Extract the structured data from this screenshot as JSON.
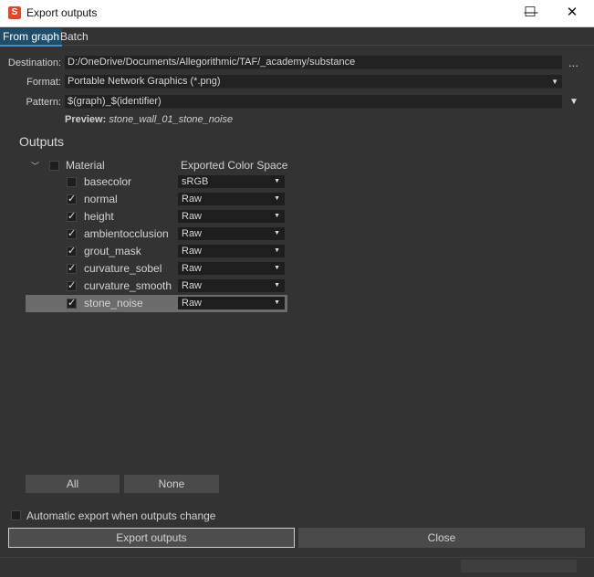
{
  "window": {
    "title": "Export outputs",
    "app_icon": "S",
    "controls": {
      "minimize": "—",
      "maximize": "☐",
      "close": "✕"
    }
  },
  "tabs": [
    {
      "label": "From graph",
      "active": true
    },
    {
      "label": "Batch",
      "active": false
    }
  ],
  "form": {
    "destination_label": "Destination:",
    "destination_value": "D:/OneDrive/Documents/Allegorithmic/TAF/_academy/substance",
    "browse_label": "...",
    "format_label": "Format:",
    "format_value": "Portable Network Graphics (*.png)",
    "pattern_label": "Pattern:",
    "pattern_value": "$(graph)_$(identifier)",
    "preview_label": "Preview:",
    "preview_value": "stone_wall_01_stone_noise"
  },
  "outputs": {
    "title": "Outputs",
    "group_label": "Material",
    "column_header": "Exported Color Space",
    "items": [
      {
        "name": "basecolor",
        "checked": false,
        "color_space": "sRGB"
      },
      {
        "name": "normal",
        "checked": true,
        "color_space": "Raw"
      },
      {
        "name": "height",
        "checked": true,
        "color_space": "Raw"
      },
      {
        "name": "ambientocclusion",
        "checked": true,
        "color_space": "Raw"
      },
      {
        "name": "grout_mask",
        "checked": true,
        "color_space": "Raw"
      },
      {
        "name": "curvature_sobel",
        "checked": true,
        "color_space": "Raw"
      },
      {
        "name": "curvature_smooth",
        "checked": true,
        "color_space": "Raw"
      },
      {
        "name": "stone_noise",
        "checked": true,
        "color_space": "Raw",
        "selected": true
      }
    ]
  },
  "buttons": {
    "all": "All",
    "none": "None",
    "export": "Export outputs",
    "close": "Close"
  },
  "auto_export": {
    "label": "Automatic export when outputs change",
    "checked": false
  },
  "colors": {
    "background": "#333333",
    "field": "#222222",
    "selected_row": "#6c6c6c",
    "active_tab": "#1f4e6d",
    "app_icon": "#e0482a"
  }
}
